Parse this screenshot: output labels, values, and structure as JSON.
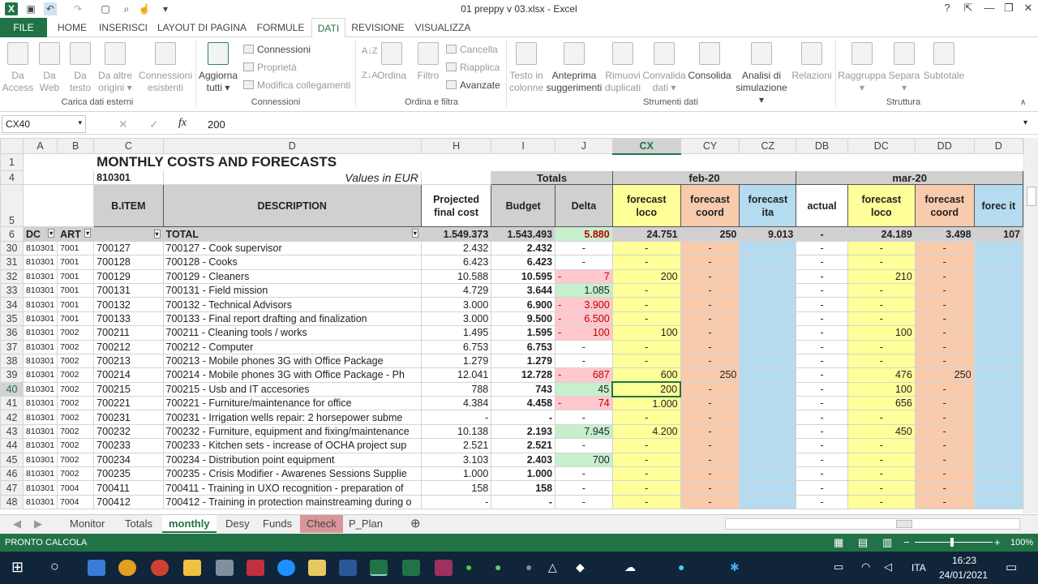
{
  "window": {
    "title": "01 preppy v 03.xlsx - Excel",
    "help": "?",
    "minimize": "—",
    "restore": "❐",
    "close": "✕"
  },
  "qat": {
    "save_icon": "save-icon",
    "undo_icon": "undo-icon",
    "redo_icon": "redo-icon",
    "new_icon": "new-icon",
    "preview_icon": "print-preview-icon",
    "more": "▾"
  },
  "tabs": [
    "FILE",
    "HOME",
    "INSERISCI",
    "LAYOUT DI PAGINA",
    "FORMULE",
    "DATI",
    "REVISIONE",
    "VISUALIZZA"
  ],
  "ribbon": {
    "big": [
      {
        "l1": "Da",
        "l2": "Access"
      },
      {
        "l1": "Da",
        "l2": "Web"
      },
      {
        "l1": "Da",
        "l2": "testo"
      },
      {
        "l1": "Da altre",
        "l2": "origini ▾"
      },
      {
        "l1": "Connessioni",
        "l2": "esistenti"
      },
      {
        "l1": "Aggiorna",
        "l2": "tutti ▾"
      },
      {
        "l1": "Ordina",
        "l2": ""
      },
      {
        "l1": "Filtro",
        "l2": ""
      },
      {
        "l1": "Testo in",
        "l2": "colonne"
      },
      {
        "l1": "Anteprima",
        "l2": "suggerimenti"
      },
      {
        "l1": "Rimuovi",
        "l2": "duplicati"
      },
      {
        "l1": "Convalida",
        "l2": "dati ▾"
      },
      {
        "l1": "Consolida",
        "l2": ""
      },
      {
        "l1": "Analisi di",
        "l2": "simulazione ▾"
      },
      {
        "l1": "Relazioni",
        "l2": ""
      },
      {
        "l1": "Raggruppa",
        "l2": "▾"
      },
      {
        "l1": "Separa",
        "l2": "▾"
      },
      {
        "l1": "Subtotale",
        "l2": ""
      }
    ],
    "small": [
      "Connessioni",
      "Proprietà",
      "Modifica collegamenti",
      "Cancella",
      "Riapplica",
      "Avanzate"
    ],
    "groups": [
      "Carica dati esterni",
      "Connessioni",
      "Ordina e filtra",
      "Strumenti dati",
      "Struttura"
    ]
  },
  "formula": {
    "namebox": "CX40",
    "cancel": "✕",
    "enter": "✓",
    "fx": "fx",
    "value": "200"
  },
  "cols": [
    "A",
    "B",
    "C",
    "D",
    "H",
    "I",
    "J",
    "CX",
    "CY",
    "CZ",
    "DB",
    "DC",
    "DD",
    "D"
  ],
  "sheet": {
    "title": "MONTHLY COSTS AND FORECASTS",
    "code": "810301",
    "values_note": "Values in EUR",
    "totals": "Totals",
    "feb": "feb-20",
    "mar": "mar-20",
    "h_bitem": "B.ITEM",
    "h_desc": "DESCRIPTION",
    "h_proj": "Projected final cost",
    "h_budget": "Budget",
    "h_delta": "Delta",
    "h_fl": "forecast loco",
    "h_fc": "forecast coord",
    "h_fi": "forecast ita",
    "h_actual": "actual",
    "h_fi2": "forec it",
    "f_dc": "DC",
    "f_art": "ART",
    "f_total": "TOTAL",
    "total_row": {
      "proj": "1.549.373",
      "budget": "1.543.493",
      "delta": "5.880",
      "cx": "24.751",
      "cy": "250",
      "cz": "9.013",
      "db": "-",
      "dc": "24.189",
      "dd": "3.498",
      "d": "107"
    },
    "rownums": [
      "1",
      "4",
      "5",
      "6"
    ],
    "rows": [
      {
        "n": "30",
        "a": "810301",
        "b": "7001",
        "c": "700127",
        "d": "700127 - Cook supervisor",
        "h": "2.432",
        "i": "2.432",
        "j": "-",
        "jc": "",
        "cx": "-",
        "cy": "-",
        "db": "-",
        "dc": "-",
        "dd": "-"
      },
      {
        "n": "31",
        "a": "810301",
        "b": "7001",
        "c": "700128",
        "d": "700128 - Cooks",
        "h": "6.423",
        "i": "6.423",
        "j": "-",
        "jc": "",
        "cx": "-",
        "cy": "-",
        "db": "-",
        "dc": "-",
        "dd": "-"
      },
      {
        "n": "32",
        "a": "810301",
        "b": "7001",
        "c": "700129",
        "d": "700129 - Cleaners",
        "h": "10.588",
        "i": "10.595",
        "j": "7",
        "jc": "red",
        "cx": "200",
        "cy": "-",
        "db": "-",
        "dc": "210",
        "dd": "-"
      },
      {
        "n": "33",
        "a": "810301",
        "b": "7001",
        "c": "700131",
        "d": "700131 - Field mission",
        "h": "4.729",
        "i": "3.644",
        "j": "1.085",
        "jc": "grn",
        "cx": "-",
        "cy": "-",
        "db": "-",
        "dc": "-",
        "dd": "-"
      },
      {
        "n": "34",
        "a": "810301",
        "b": "7001",
        "c": "700132",
        "d": "700132 - Technical Advisors",
        "h": "3.000",
        "i": "6.900",
        "j": "3.900",
        "jc": "red",
        "cx": "-",
        "cy": "-",
        "db": "-",
        "dc": "-",
        "dd": "-"
      },
      {
        "n": "35",
        "a": "810301",
        "b": "7001",
        "c": "700133",
        "d": "700133 - Final report drafting and finalization",
        "h": "3.000",
        "i": "9.500",
        "j": "6.500",
        "jc": "red",
        "cx": "-",
        "cy": "-",
        "db": "-",
        "dc": "-",
        "dd": "-"
      },
      {
        "n": "36",
        "a": "810301",
        "b": "7002",
        "c": "700211",
        "d": "700211 - Cleaning tools / works",
        "h": "1.495",
        "i": "1.595",
        "j": "100",
        "jc": "red",
        "cx": "100",
        "cy": "-",
        "db": "-",
        "dc": "100",
        "dd": "-"
      },
      {
        "n": "37",
        "a": "810301",
        "b": "7002",
        "c": "700212",
        "d": "700212 - Computer",
        "h": "6.753",
        "i": "6.753",
        "j": "-",
        "jc": "",
        "cx": "-",
        "cy": "-",
        "db": "-",
        "dc": "-",
        "dd": "-"
      },
      {
        "n": "38",
        "a": "810301",
        "b": "7002",
        "c": "700213",
        "d": "700213 - Mobile phones 3G with Office Package",
        "h": "1.279",
        "i": "1.279",
        "j": "-",
        "jc": "",
        "cx": "-",
        "cy": "-",
        "db": "-",
        "dc": "-",
        "dd": "-"
      },
      {
        "n": "39",
        "a": "810301",
        "b": "7002",
        "c": "700214",
        "d": "700214 - Mobile phones 3G with Office Package - Ph",
        "h": "12.041",
        "i": "12.728",
        "j": "687",
        "jc": "red",
        "cx": "600",
        "cy": "250",
        "db": "-",
        "dc": "476",
        "dd": "250"
      },
      {
        "n": "40",
        "a": "810301",
        "b": "7002",
        "c": "700215",
        "d": "700215 - Usb and IT accesories",
        "h": "788",
        "i": "743",
        "j": "45",
        "jc": "grn",
        "cx": "200",
        "cy": "-",
        "db": "-",
        "dc": "100",
        "dd": "-"
      },
      {
        "n": "41",
        "a": "810301",
        "b": "7002",
        "c": "700221",
        "d": "700221 - Furniture/maintenance for office",
        "h": "4.384",
        "i": "4.458",
        "j": "74",
        "jc": "red",
        "cx": "1.000",
        "cy": "-",
        "db": "-",
        "dc": "656",
        "dd": "-"
      },
      {
        "n": "42",
        "a": "810301",
        "b": "7002",
        "c": "700231",
        "d": "700231 - Irrigation wells repair: 2 horsepower subme",
        "h": "-",
        "i": "-",
        "j": "-",
        "jc": "",
        "cx": "-",
        "cy": "-",
        "db": "-",
        "dc": "-",
        "dd": "-"
      },
      {
        "n": "43",
        "a": "810301",
        "b": "7002",
        "c": "700232",
        "d": "700232 - Furniture, equipment and fixing/maintenance",
        "h": "10.138",
        "i": "2.193",
        "j": "7.945",
        "jc": "grn",
        "cx": "4.200",
        "cy": "-",
        "db": "-",
        "dc": "450",
        "dd": "-"
      },
      {
        "n": "44",
        "a": "810301",
        "b": "7002",
        "c": "700233",
        "d": "700233 - Kitchen sets - increase of OCHA project sup",
        "h": "2.521",
        "i": "2.521",
        "j": "-",
        "jc": "",
        "cx": "-",
        "cy": "-",
        "db": "-",
        "dc": "-",
        "dd": "-"
      },
      {
        "n": "45",
        "a": "810301",
        "b": "7002",
        "c": "700234",
        "d": "700234 - Distribution point equipment",
        "h": "3.103",
        "i": "2.403",
        "j": "700",
        "jc": "grn",
        "cx": "-",
        "cy": "-",
        "db": "-",
        "dc": "-",
        "dd": "-"
      },
      {
        "n": "46",
        "a": "810301",
        "b": "7002",
        "c": "700235",
        "d": "700235 - Crisis Modifier - Awarenes Sessions Supplie",
        "h": "1.000",
        "i": "1.000",
        "j": "-",
        "jc": "",
        "cx": "-",
        "cy": "-",
        "db": "-",
        "dc": "-",
        "dd": "-"
      },
      {
        "n": "47",
        "a": "810301",
        "b": "7004",
        "c": "700411",
        "d": "700411 - Training in UXO recognition - preparation of",
        "h": "158",
        "i": "158",
        "j": "-",
        "jc": "",
        "cx": "-",
        "cy": "-",
        "db": "-",
        "dc": "-",
        "dd": "-"
      },
      {
        "n": "48",
        "a": "810301",
        "b": "7004",
        "c": "700412",
        "d": "700412 - Training in protection mainstreaming during o",
        "h": "-",
        "i": "-",
        "j": "-",
        "jc": "",
        "cx": "-",
        "cy": "-",
        "db": "-",
        "dc": "-",
        "dd": "-"
      }
    ]
  },
  "sheettabs": [
    "Monitor",
    "Totals",
    "monthly",
    "Desy",
    "Funds",
    "Check",
    "P_Plan"
  ],
  "status": {
    "left1": "PRONTO",
    "left2": "CALCOLA",
    "zoom": "100%",
    "zoom_minus": "−",
    "zoom_plus": "+"
  },
  "taskbar": {
    "lang": "ITA",
    "time": "16:23",
    "date": "24/01/2021"
  },
  "colors": {
    "excel_green": "#217346",
    "forecast_loco": "#ffff99",
    "forecast_coord": "#f8cbad",
    "forecast_ita": "#b4dbf0"
  }
}
